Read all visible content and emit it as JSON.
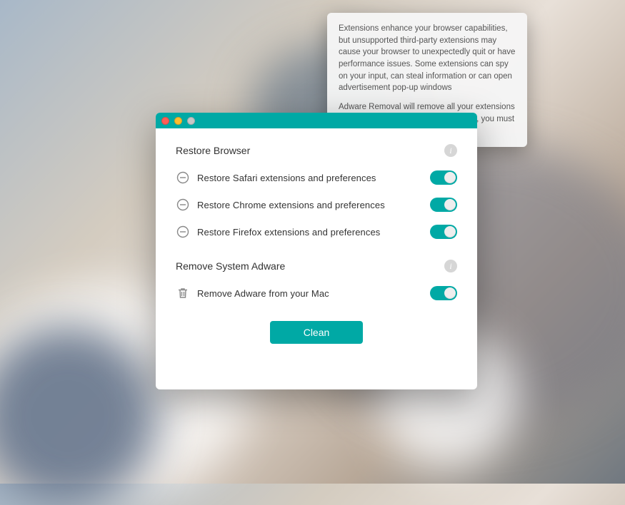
{
  "sections": {
    "browser": {
      "title": "Restore Browser",
      "items": [
        {
          "label": "Restore Safari extensions and preferences"
        },
        {
          "label": "Restore Chrome extensions and preferences"
        },
        {
          "label": "Restore Firefox extensions and preferences"
        }
      ]
    },
    "system": {
      "title": "Remove System Adware",
      "items": [
        {
          "label": "Remove Adware from your Mac"
        }
      ]
    }
  },
  "tooltip": {
    "p1": "Extensions enhance your browser capabilities, but unsupported third-party extensions may cause your browser to unexpectedly quit or have performance issues. Some extensions can spy on your input, can steal information or can open advertisement pop-up windows",
    "p2": "Adware Removal will remove all your extensions If you have extensions that are usefull, you must reinstall them."
  },
  "buttons": {
    "clean": "Clean"
  },
  "glyphs": {
    "info": "i"
  }
}
